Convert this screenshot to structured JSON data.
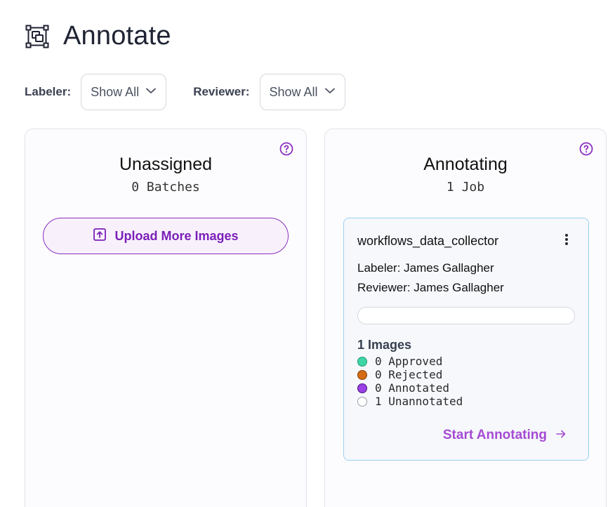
{
  "header": {
    "title": "Annotate",
    "icon": "annotate-icon"
  },
  "filters": {
    "labeler": {
      "label": "Labeler:",
      "value": "Show All"
    },
    "reviewer": {
      "label": "Reviewer:",
      "value": "Show All"
    }
  },
  "columns": {
    "unassigned": {
      "title": "Unassigned",
      "subtitle": "0 Batches",
      "upload_button": "Upload More Images"
    },
    "annotating": {
      "title": "Annotating",
      "subtitle": "1 Job",
      "job": {
        "name": "workflows_data_collector",
        "labeler": "Labeler: James Gallagher",
        "reviewer": "Reviewer: James Gallagher",
        "progress": 0,
        "images": "1 Images",
        "stats": {
          "approved": "0 Approved",
          "rejected": "0 Rejected",
          "annotated": "0 Annotated",
          "unannotated": "1 Unannotated"
        },
        "start_label": "Start Annotating"
      }
    }
  },
  "colors": {
    "accent": "#7b1fb8",
    "approved": "#3fd6a4",
    "rejected": "#d46a12",
    "annotated": "#9b40e6",
    "unannotated": "#ffffff"
  }
}
